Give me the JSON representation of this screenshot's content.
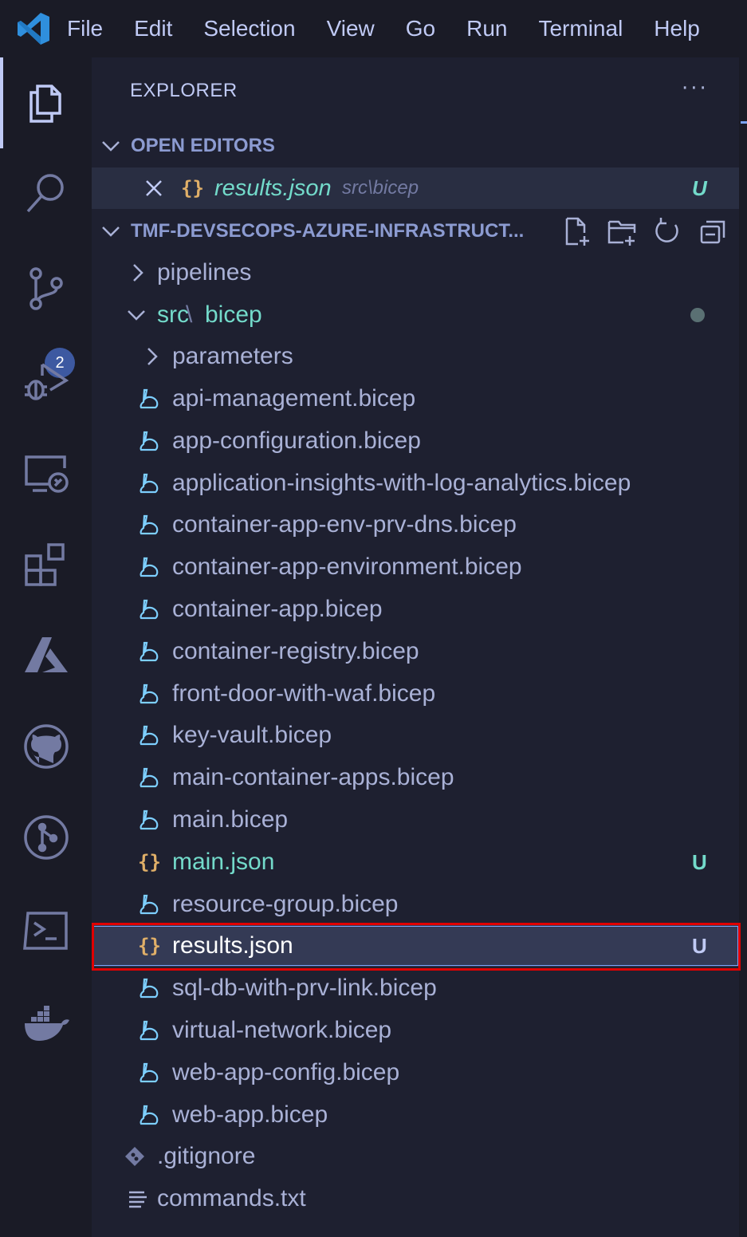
{
  "menubar": {
    "items": [
      "File",
      "Edit",
      "Selection",
      "View",
      "Go",
      "Run",
      "Terminal",
      "Help"
    ]
  },
  "activity": {
    "icons": [
      "explorer-icon",
      "search-icon",
      "source-control-icon",
      "run-debug-icon",
      "remote-explorer-icon",
      "extensions-icon",
      "azure-icon",
      "github-icon",
      "git-graph-icon",
      "terminal-icon",
      "docker-icon"
    ],
    "source_control_badge": "2"
  },
  "explorer": {
    "title": "EXPLORER",
    "more": "···",
    "open_editors": {
      "header": "OPEN EDITORS",
      "file": {
        "name": "results.json",
        "path": "src\\bicep",
        "status": "U"
      }
    },
    "workspace": {
      "header": "TMF-DEVSECOPS-AZURE-INFRASTRUCT...",
      "folders": {
        "pipelines": "pipelines",
        "src": "src",
        "bicep": "bicep",
        "parameters": "parameters"
      },
      "files": [
        {
          "name": "api-management.bicep"
        },
        {
          "name": "app-configuration.bicep"
        },
        {
          "name": "application-insights-with-log-analytics.bicep"
        },
        {
          "name": "container-app-env-prv-dns.bicep"
        },
        {
          "name": "container-app-environment.bicep"
        },
        {
          "name": "container-app.bicep"
        },
        {
          "name": "container-registry.bicep"
        },
        {
          "name": "front-door-with-waf.bicep"
        },
        {
          "name": "key-vault.bicep"
        },
        {
          "name": "main-container-apps.bicep"
        },
        {
          "name": "main.bicep"
        },
        {
          "name": "main.json",
          "status": "U"
        },
        {
          "name": "resource-group.bicep"
        },
        {
          "name": "results.json",
          "status": "U"
        },
        {
          "name": "sql-db-with-prv-link.bicep"
        },
        {
          "name": "virtual-network.bicep"
        },
        {
          "name": "web-app-config.bicep"
        },
        {
          "name": "web-app.bicep"
        }
      ],
      "root_files": [
        {
          "name": ".gitignore"
        },
        {
          "name": "commands.txt"
        }
      ]
    }
  },
  "colors": {
    "background": "#1e2030",
    "activity_bar": "#1a1b26",
    "untracked": "#73daca",
    "json_icon": "#e0af68",
    "bicep_icon": "#7dcfff",
    "highlight": "#e00000"
  }
}
